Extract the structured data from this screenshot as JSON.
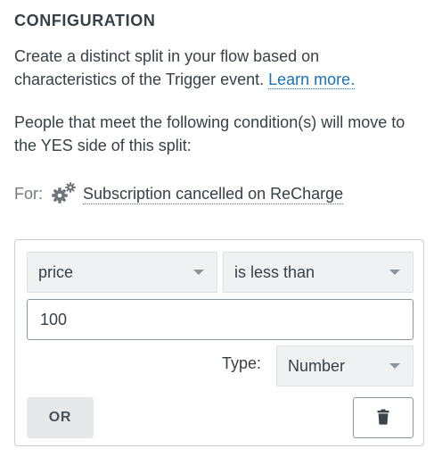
{
  "header": {
    "title": "CONFIGURATION"
  },
  "description": {
    "text": "Create a distinct split in your flow based on characteristics of the Trigger event. ",
    "learn_more_label": "Learn more."
  },
  "condition_intro": "People that meet the following condition(s) will move to the YES side of this split:",
  "trigger": {
    "for_label": "For:",
    "icon": "gears-icon",
    "name": "Subscription cancelled on ReCharge"
  },
  "condition": {
    "field": "price",
    "operator": "is less than",
    "value": "100",
    "type_label": "Type:",
    "type_value": "Number",
    "or_label": "OR",
    "delete_icon": "trash-icon"
  },
  "colors": {
    "text": "#373f47",
    "link": "#1a73b8",
    "muted": "#737a80",
    "select_bg": "#f0f1f2",
    "border": "#c9ced3"
  }
}
